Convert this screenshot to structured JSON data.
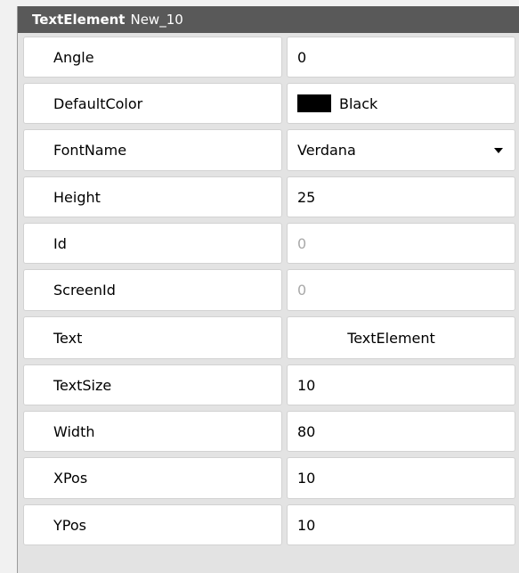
{
  "header": {
    "type_label": "TextElement",
    "name_label": "New_10"
  },
  "properties": [
    {
      "name": "Angle",
      "value": "0"
    },
    {
      "name": "DefaultColor",
      "value": "Black",
      "swatch_color": "#000000"
    },
    {
      "name": "FontName",
      "value": "Verdana"
    },
    {
      "name": "Height",
      "value": "25"
    },
    {
      "name": "Id",
      "value": "0"
    },
    {
      "name": "ScreenId",
      "value": "0"
    },
    {
      "name": "Text",
      "value": "TextElement"
    },
    {
      "name": "TextSize",
      "value": "10"
    },
    {
      "name": "Width",
      "value": "80"
    },
    {
      "name": "XPos",
      "value": "10"
    },
    {
      "name": "YPos",
      "value": "10"
    }
  ],
  "colors": {
    "header_background": "#595959",
    "panel_background": "#e3e3e3",
    "cell_background": "#ffffff",
    "readonly_text": "#a9a9a9"
  }
}
